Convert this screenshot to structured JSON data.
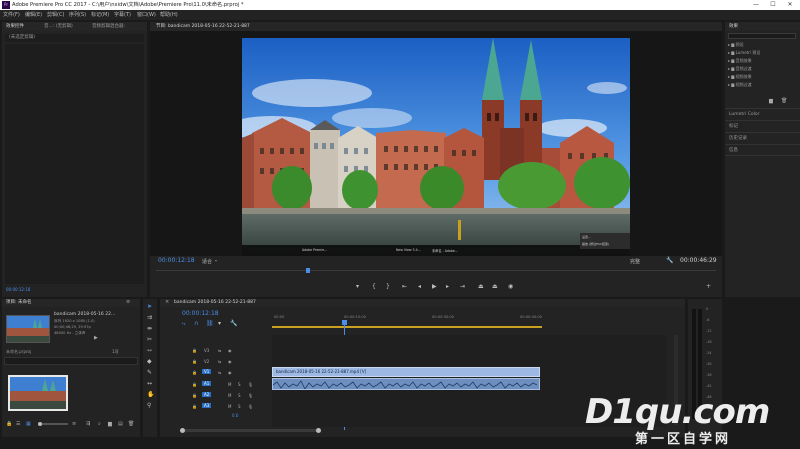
{
  "window": {
    "app_icon": "Pr",
    "title": "Adobe Premiere Pro CC 2017 - C:\\用户\\nxidw\\文档\\Adobe\\Premiere Pro\\11.0\\未命名.prproj *",
    "minimize": "—",
    "maximize": "☐",
    "close": "✕"
  },
  "menu": [
    "文件(F)",
    "编辑(E)",
    "剪辑(C)",
    "序列(S)",
    "标记(M)",
    "字幕(T)",
    "窗口(W)",
    "帮助(H)"
  ],
  "source_panel": {
    "tabs": [
      "效果控件",
      "音...: (无剪辑)",
      "音频剪辑混合器: "
    ],
    "no_clip": "(未选定剪辑)",
    "timecode": "00:00:12:18"
  },
  "program": {
    "tab": "节目: bandicam 2018-05-16 22-52-21-887",
    "timecode_left": "00:00:12:18",
    "fit": "适合",
    "quality": "完整",
    "timecode_right": "00:00:46:29",
    "taskbar_items": [
      "Adobe Premie...",
      "New View 3.4...",
      "未命名 - Adobe..."
    ],
    "context_menu": [
      "设置...",
      "播放 (按住ESC结束)"
    ]
  },
  "effects_panel": {
    "tab": "效果",
    "tree": [
      "预设",
      "Lumetri 预设",
      "音频效果",
      "音频过渡",
      "视频效果",
      "视频过渡"
    ],
    "lumetri": "Lumetri Color",
    "sections": [
      "标记",
      "历史记录",
      "信息"
    ]
  },
  "project": {
    "tab": "项目: 未命名",
    "clip_name": "bandicam 2018-05-16 22...",
    "clip_info_1": "序列 1920 x 1080 (1.0)",
    "clip_info_2": "00;00;46;29, 29.97p",
    "clip_info_3": "48000 Hz - 立体声",
    "bin_name": "未命名.prproj",
    "items_count": "1项"
  },
  "timeline": {
    "tab": "bandicam 2018-05-16 22-52-21-887",
    "timecode": "00:00:12:18",
    "ruler": [
      "00:00",
      "00:00:15:00",
      "00:00:30:00",
      "00:00:45:00"
    ],
    "video_tracks": [
      "V3",
      "V2",
      "V1"
    ],
    "audio_tracks": [
      "A1",
      "A2",
      "A3"
    ],
    "clip_label": "bandicam 2018-05-16 22-52-21-887.mp4 [V]",
    "mix_value": "0.0"
  },
  "meter_scale": [
    "0",
    "-6",
    "-12",
    "-18",
    "-24",
    "-30",
    "-36",
    "-42",
    "-48",
    "-54"
  ],
  "watermark": {
    "brand": "D1qu.com",
    "sub": "第一区自学网"
  }
}
